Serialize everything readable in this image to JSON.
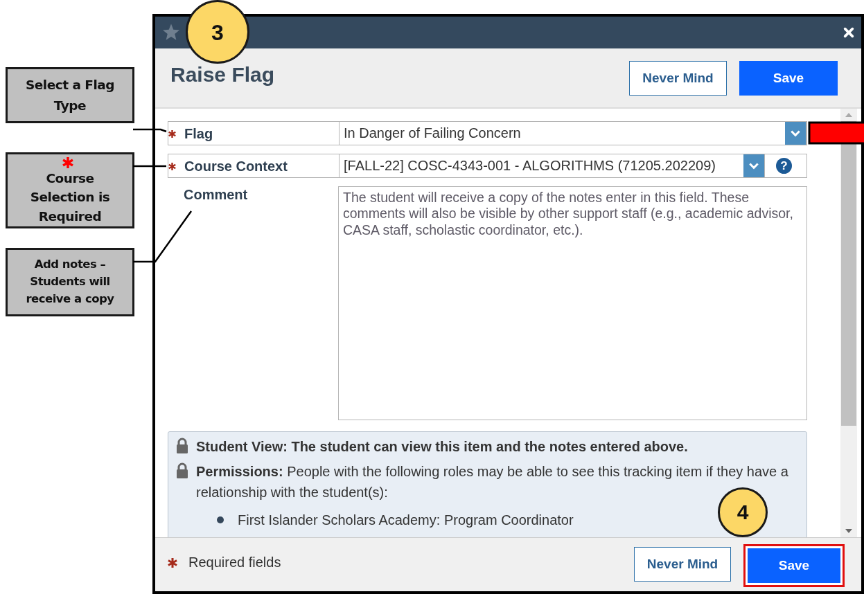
{
  "callouts": [
    {
      "text": "Select a Flag Type",
      "required": false
    },
    {
      "text": "Course Selection is Required",
      "required": true
    },
    {
      "text": "Add notes – Students will receive a copy",
      "required": false
    }
  ],
  "step_badges": [
    {
      "label": "3"
    },
    {
      "label": "4"
    }
  ],
  "dialog": {
    "title": "Raise Flag",
    "header_buttons": [
      {
        "label": "Never Mind",
        "kind": "secondary",
        "highlighted": false
      },
      {
        "label": "Save",
        "kind": "primary",
        "highlighted": false
      }
    ],
    "fields": [
      {
        "label": "Flag",
        "required": true,
        "kind": "select",
        "value": "In Danger of Failing Concern"
      },
      {
        "label": "Course Context",
        "required": true,
        "kind": "select",
        "value": "[FALL-22] COSC-4343-001 - ALGORITHMS (71205.202209)",
        "help": "?"
      },
      {
        "label": "Comment",
        "required": false,
        "kind": "textarea",
        "placeholder": "The student will receive a copy of the notes enter in this field. These comments will also be visible by other support staff (e.g., academic advisor, CASA staff, scholastic coordinator, etc.)."
      }
    ],
    "info": [
      {
        "kind": "lock",
        "text": "Student View: The student can view this item and the notes entered above.",
        "bold": true
      },
      {
        "kind": "lock",
        "text": "**Permissions:** People with the following roles may be able to see this tracking item if they have a relationship with the student(s):",
        "bold": false
      },
      {
        "kind": "bullet",
        "text": "First Islander Scholars Academy: Program Coordinator",
        "bold": false
      }
    ],
    "footer": {
      "required_note": "Required fields",
      "buttons": [
        {
          "label": "Never Mind",
          "kind": "secondary",
          "highlighted": false
        },
        {
          "label": "Save",
          "kind": "primary",
          "highlighted": true
        }
      ]
    }
  }
}
